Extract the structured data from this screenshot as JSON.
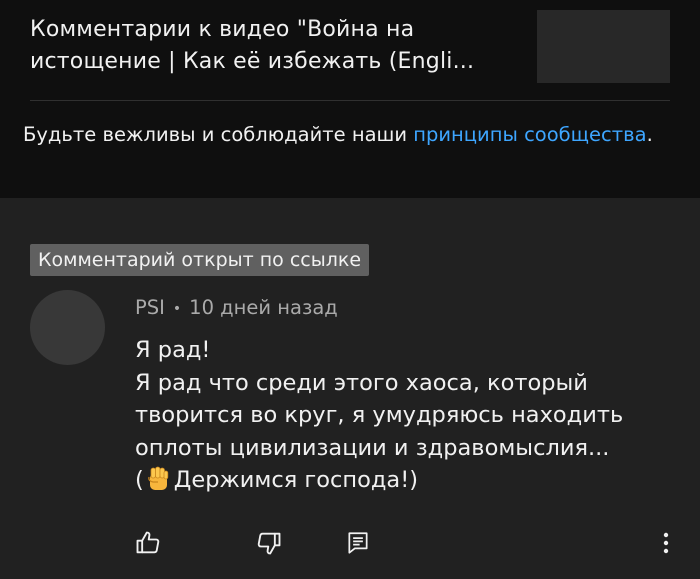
{
  "header": {
    "title_line1": "Комментарии к видео \"Война на",
    "title_line2": "истощение | Как её избежать (Engli...",
    "notice_prefix": "Будьте вежливы и соблюдайте наши ",
    "notice_link": "принципы сообщества",
    "notice_suffix": "."
  },
  "comment": {
    "linked_badge": "Комментарий открыт по ссылке",
    "author": "PSI",
    "separator": "•",
    "time": "10 дней назад",
    "lines": [
      "Я рад!",
      "Я рад что среди этого хаоса, который",
      "творится во круг, я умудряюсь находить",
      "оплоты цивилизации и здравомыслия...",
      "(",
      "Держимся господа!)"
    ]
  },
  "actions": {
    "icons": [
      "thumb-up-icon",
      "thumb-down-icon",
      "reply-icon",
      "more-vert-icon"
    ]
  },
  "colors": {
    "header_bg": "#0f0f0f",
    "body_bg": "#212121",
    "link": "#3ea6ff",
    "badge_bg": "#606060",
    "secondary_text": "#aaaaaa"
  }
}
